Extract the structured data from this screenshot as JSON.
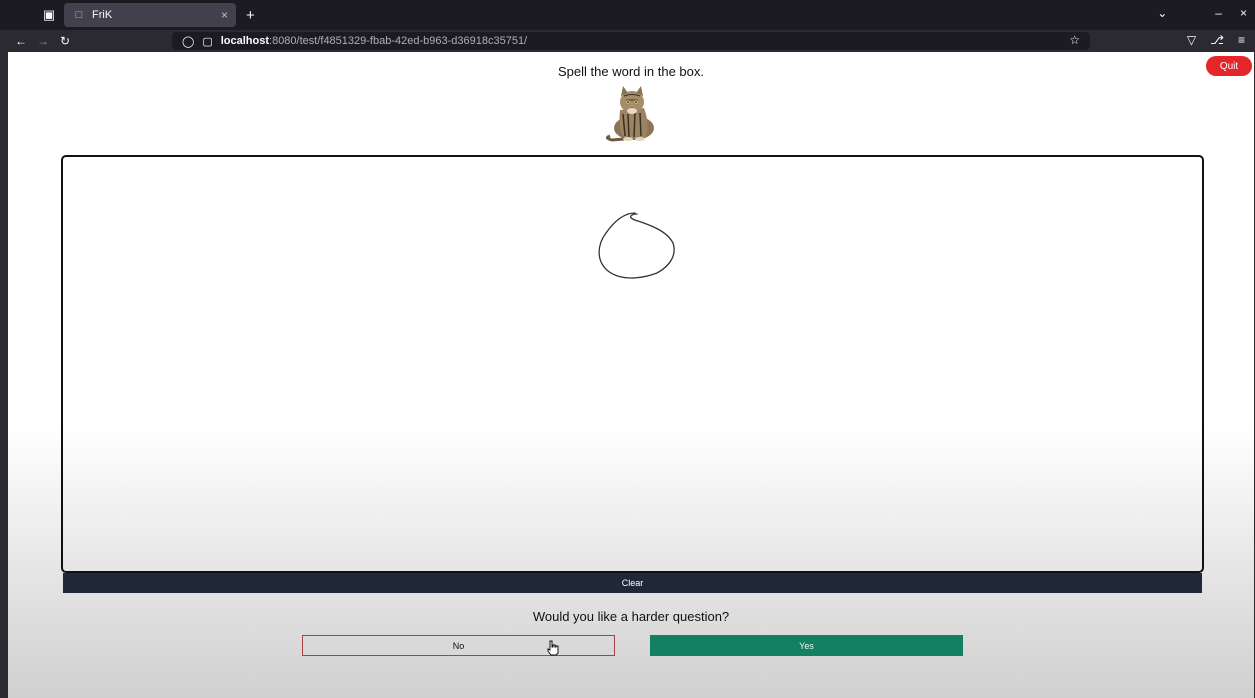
{
  "browser": {
    "tab": {
      "title": "FriK",
      "close": "×"
    },
    "new_tab": "+",
    "url_host": "localhost",
    "url_path": ":8080/test/f4851329-fbab-42ed-b963-d36918c35751/",
    "icons": {
      "tab_list": "tab-list-icon",
      "back": "arrow-left-icon",
      "forward": "arrow-right-icon",
      "reload": "reload-icon",
      "shield": "shield-icon",
      "page": "page-icon",
      "star": "star-icon",
      "pocket": "pocket-icon",
      "extensions": "extensions-icon",
      "menu": "menu-icon"
    }
  },
  "page": {
    "quit_label": "Quit",
    "prompt": "Spell the word in the box.",
    "clear_label": "Clear",
    "question": "Would you like a harder question?",
    "no_label": "No",
    "yes_label": "Yes"
  },
  "colors": {
    "quit_bg": "#e3262a",
    "clear_bg": "#1e2837",
    "no_border": "#a8443e",
    "yes_bg": "#138061"
  }
}
